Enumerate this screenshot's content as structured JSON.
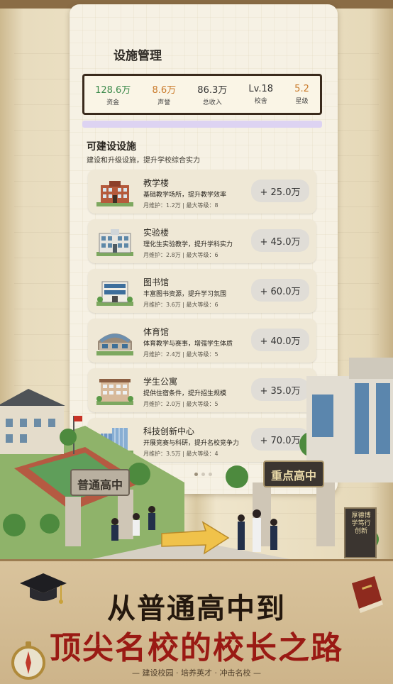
{
  "panel": {
    "title": "设施管理",
    "stats": [
      {
        "value": "128.6万",
        "label": "资金",
        "color": "#3b8a4a"
      },
      {
        "value": "8.6万",
        "label": "声誉",
        "color": "#c97a2a"
      },
      {
        "value": "86.3万",
        "label": "总收入",
        "color": "#333333"
      },
      {
        "value": "Lv.18",
        "label": "校舍",
        "color": "#333333"
      },
      {
        "value": "5.2",
        "label": "星级",
        "color": "#c97a2a"
      }
    ],
    "section_title": "可建设设施",
    "section_subtitle": "建设和升级设施，提升学校综合实力",
    "items": [
      {
        "icon": "teaching-building-icon",
        "name": "教学楼",
        "desc": "基础教学场所，提升教学效率",
        "upkeep": "月维护：1.2万",
        "max": "最大等级：8",
        "cost": "+ 25.0万"
      },
      {
        "icon": "lab-building-icon",
        "name": "实验楼",
        "desc": "理化生实验教学，提升学科实力",
        "upkeep": "月维护：2.8万",
        "max": "最大等级：6",
        "cost": "+ 45.0万"
      },
      {
        "icon": "library-icon",
        "name": "图书馆",
        "desc": "丰富图书资源，提升学习氛围",
        "upkeep": "月维护：3.6万",
        "max": "最大等级：6",
        "cost": "+ 60.0万"
      },
      {
        "icon": "gym-icon",
        "name": "体育馆",
        "desc": "体育教学与赛事，增强学生体质",
        "upkeep": "月维护：2.4万",
        "max": "最大等级：5",
        "cost": "+ 40.0万"
      },
      {
        "icon": "dormitory-icon",
        "name": "学生公寓",
        "desc": "提供住宿条件，提升招生规模",
        "upkeep": "月维护：2.0万",
        "max": "最大等级：5",
        "cost": "+ 35.0万"
      },
      {
        "icon": "innovation-center-icon",
        "name": "科技创新中心",
        "desc": "开展竞赛与科研，提升名校竞争力",
        "upkeep": "月维护：3.5万",
        "max": "最大等级：4",
        "cost": "+ 70.0万"
      }
    ],
    "page_dots": 3,
    "active_dot": 0
  },
  "scene": {
    "left_gate": "普通高中",
    "right_gate": "重点高中",
    "right_plaque": "厚德博学笃行创新"
  },
  "banner": {
    "line1": "从普通高中到",
    "line2": "顶尖名校的校长之路",
    "tagline": "— 建设校园 · 培养英才 · 冲击名校 —"
  }
}
